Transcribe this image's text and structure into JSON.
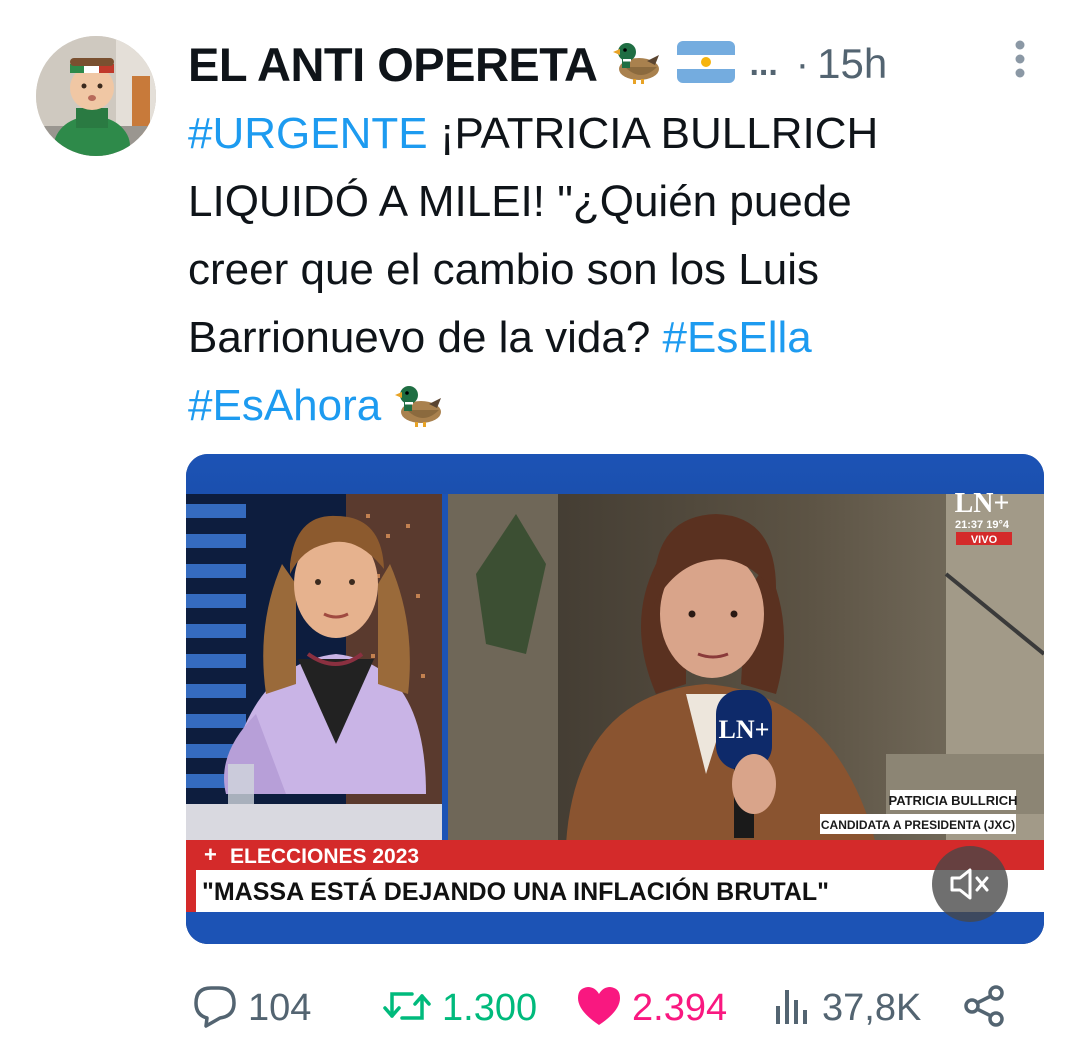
{
  "tweet": {
    "author_name": "EL ANTI OPERETA",
    "name_ellipsis": "...",
    "separator": "·",
    "time": "15h",
    "text_lines": [
      [
        {
          "t": "#URGENTE",
          "tag": true
        },
        {
          "t": " ¡PATRICIA BULLRICH",
          "tag": false
        }
      ],
      [
        {
          "t": "LIQUIDÓ A MILEI!  \"¿Quién puede",
          "tag": false
        }
      ],
      [
        {
          "t": "creer que el cambio son los Luis",
          "tag": false
        }
      ],
      [
        {
          "t": "Barrionuevo de la vida? ",
          "tag": false
        },
        {
          "t": "#EsElla",
          "tag": true
        }
      ],
      [
        {
          "t": "#EsAhora",
          "tag": true
        },
        {
          "t": " ",
          "tag": false
        },
        {
          "duck": true
        }
      ]
    ]
  },
  "media": {
    "channel_logo": "LN+",
    "clock": "21:37 19°4",
    "live_badge": "VIVO",
    "name_tag": "PATRICIA BULLRICH",
    "role_tag": "CANDIDATA A PRESIDENTA (JXC)",
    "section_label": "ELECCIONES 2023",
    "headline": "\"MASSA ESTÁ DEJANDO UNA INFLACIÓN BRUTAL\"",
    "mic_logo": "LN+"
  },
  "actions": {
    "replies": "104",
    "reposts": "1.300",
    "likes": "2.394",
    "views": "37,8K"
  },
  "colors": {
    "hashtag": "#1d9bf0",
    "muted": "#536471",
    "repost": "#00ba7c",
    "like": "#f91880",
    "ticker_red": "#d42a2a"
  },
  "icons": [
    "duck-emoji-icon",
    "argentina-flag-icon",
    "more-options-icon",
    "mute-icon",
    "reply-icon",
    "repost-icon",
    "heart-icon",
    "views-icon",
    "share-icon"
  ]
}
